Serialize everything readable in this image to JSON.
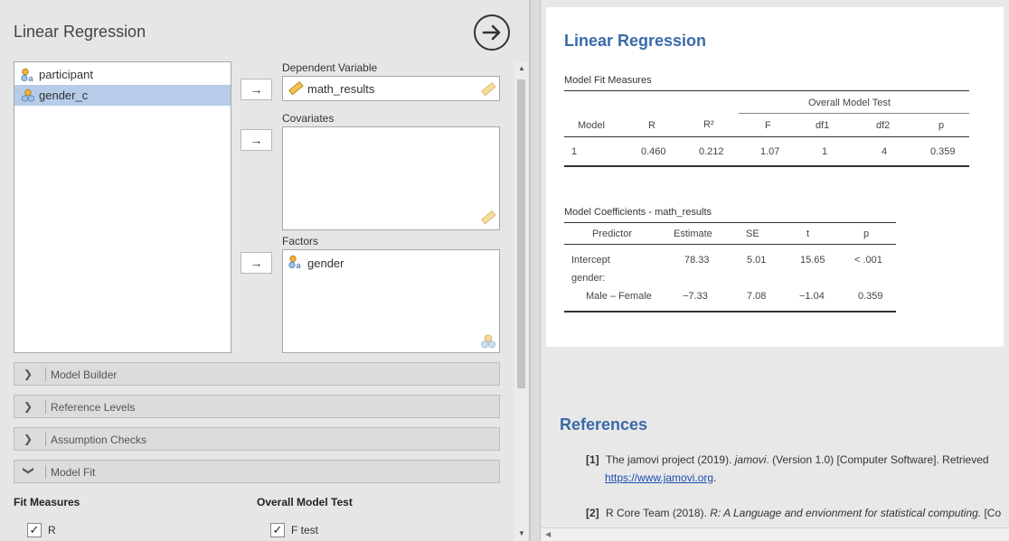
{
  "left": {
    "title": "Linear Regression",
    "variables": [
      {
        "name": "participant",
        "icon": "nominal-text-icon",
        "selected": false
      },
      {
        "name": "gender_c",
        "icon": "nominal-icon",
        "selected": true
      }
    ],
    "dependent_label": "Dependent Variable",
    "dependent_value": "math_results",
    "covariates_label": "Covariates",
    "factors_label": "Factors",
    "factors_value": "gender",
    "sections": [
      {
        "label": "Model Builder",
        "expanded": false
      },
      {
        "label": "Reference Levels",
        "expanded": false
      },
      {
        "label": "Assumption Checks",
        "expanded": false
      },
      {
        "label": "Model Fit",
        "expanded": true
      }
    ],
    "fit_measures_label": "Fit Measures",
    "overall_test_label": "Overall Model Test",
    "check_r": "R",
    "check_ftest": "F test"
  },
  "results": {
    "title": "Linear Regression",
    "fit_caption": "Model Fit Measures",
    "fit_group_header": "Overall Model Test",
    "fit_headers": [
      "Model",
      "R",
      "R²",
      "F",
      "df1",
      "df2",
      "p"
    ],
    "fit_row": [
      "1",
      "0.460",
      "0.212",
      "1.07",
      "1",
      "4",
      "0.359"
    ],
    "coef_caption": "Model Coefficients - math_results",
    "coef_headers": [
      "Predictor",
      "Estimate",
      "SE",
      "t",
      "p"
    ],
    "coef_rows": [
      [
        "Intercept",
        "78.33",
        "5.01",
        "15.65",
        "< .001"
      ],
      [
        "gender:",
        "",
        "",
        "",
        ""
      ],
      [
        "Male – Female",
        "−7.33",
        "7.08",
        "−1.04",
        "0.359"
      ]
    ],
    "references_title": "References",
    "refs": [
      {
        "num": "[1]",
        "pre": "The jamovi project (2019). ",
        "em": "jamovi",
        "post": ". (Version 1.0) [Computer Software]. Retrieved",
        "link": "https://www.jamovi.org",
        "tail": "."
      },
      {
        "num": "[2]",
        "pre": "R Core Team (2018). ",
        "em": "R: A Language and envionment for statistical computing.",
        "post": " [Co"
      }
    ]
  },
  "colors": {
    "accent": "#3a6aa8",
    "selection": "#b6cce9"
  }
}
